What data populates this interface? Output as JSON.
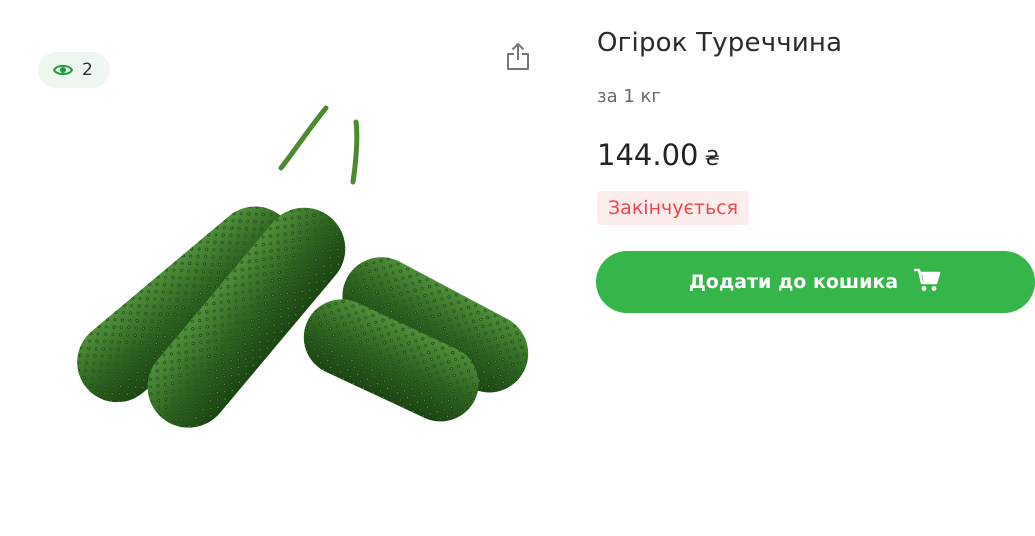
{
  "views": {
    "count": "2",
    "icon": "eye-icon"
  },
  "share": {
    "icon": "share-icon"
  },
  "product": {
    "image": "cucumbers",
    "title": "Огірок Туреччина",
    "unit": "за 1 кг",
    "price": "144.00",
    "currency": "₴",
    "stock_status": "Закінчується"
  },
  "cart_button": {
    "label": "Додати до кошика",
    "icon": "cart-icon"
  },
  "colors": {
    "accent": "#36b54a",
    "badge_bg": "#eef7f0",
    "stock_text": "#e94a4a",
    "stock_bg": "#fdecec"
  }
}
